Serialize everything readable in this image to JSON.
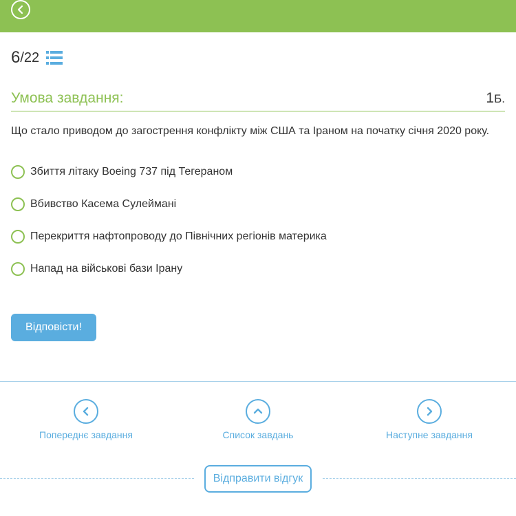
{
  "colors": {
    "header_bg": "#8dc153",
    "accent_green": "#8dc153",
    "accent_blue": "#5aaddf",
    "text": "#333333"
  },
  "header": {
    "back_icon": "chevron-left-icon"
  },
  "progress": {
    "current": "6",
    "separator": "/",
    "total": "22",
    "list_icon": "list-icon"
  },
  "condition": {
    "title": "Умова завдання:",
    "points": "1",
    "points_unit": "Б."
  },
  "question": {
    "text": "Що стало приводом до загострення конфлікту між США та Іраном на початку січня 2020 року."
  },
  "options": [
    {
      "label": "Збиття літаку Boeing 737 під Тегераном"
    },
    {
      "label": "Вбивство Касема Сулеймані"
    },
    {
      "label": "Перекриття нафтопроводу до Північних регіонів материка"
    },
    {
      "label": "Напад на військові бази Ірану"
    }
  ],
  "answer_button": {
    "label": "Відповісти!"
  },
  "nav": {
    "prev": {
      "label": "Попереднє завдання",
      "icon": "chevron-left-icon"
    },
    "list": {
      "label": "Список завдань",
      "icon": "chevron-up-icon"
    },
    "next": {
      "label": "Наступне завдання",
      "icon": "chevron-right-icon"
    }
  },
  "feedback_button": {
    "label": "Відправити відгук"
  }
}
